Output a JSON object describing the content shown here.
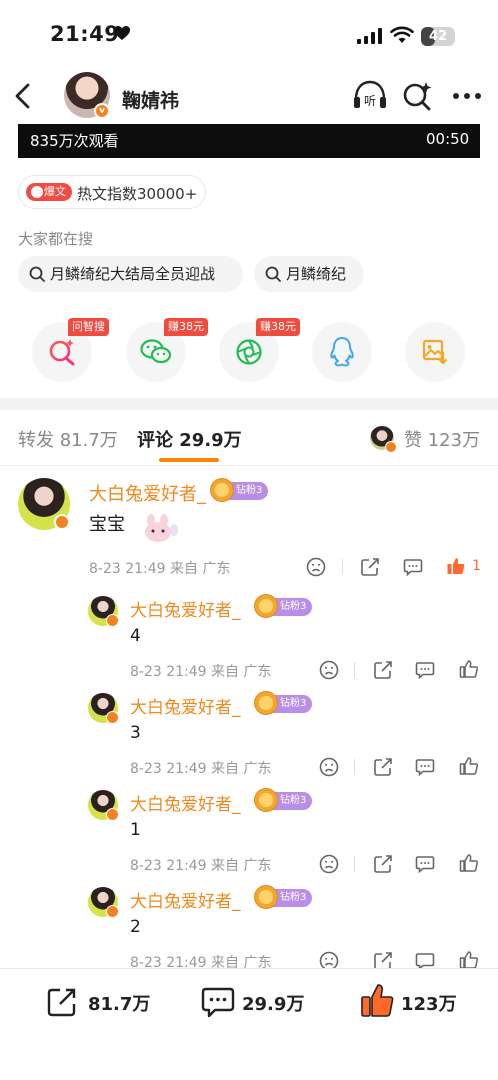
{
  "status_bar": {
    "time": "21:49",
    "battery": "42"
  },
  "nav": {
    "username": "鞠婧祎",
    "avatar_badge": "v"
  },
  "video": {
    "views": "835万次观看",
    "duration": "00:50"
  },
  "hot": {
    "tag": "爆文",
    "text": "热文指数30000+"
  },
  "search_section": {
    "label": "大家都在搜",
    "chips": [
      "月鳞绮纪大结局全员迎战",
      "月鳞绮纪"
    ]
  },
  "share": {
    "items": [
      {
        "icon": "ask-search-icon",
        "tag": "问智搜"
      },
      {
        "icon": "wechat-icon",
        "tag": "赚38元"
      },
      {
        "icon": "moments-icon",
        "tag": "赚38元"
      },
      {
        "icon": "qq-icon",
        "tag": ""
      },
      {
        "icon": "save-image-icon",
        "tag": ""
      }
    ]
  },
  "tabs": {
    "repost": "转发 81.7万",
    "comment": "评论 29.9万",
    "like": "赞 123万"
  },
  "main_comment": {
    "name": "大白兔爱好者_",
    "fan_badge": "钻粉3",
    "text": "宝宝",
    "meta": "8-23 21:49 来自 广东",
    "likes": "1"
  },
  "replies": [
    {
      "name": "大白兔爱好者_",
      "fan_badge": "钻粉3",
      "text": "4",
      "meta": "8-23 21:49 来自 广东"
    },
    {
      "name": "大白兔爱好者_",
      "fan_badge": "钻粉3",
      "text": "3",
      "meta": "8-23 21:49 来自 广东"
    },
    {
      "name": "大白兔爱好者_",
      "fan_badge": "钻粉3",
      "text": "1",
      "meta": "8-23 21:49 来自 广东"
    },
    {
      "name": "大白兔爱好者_",
      "fan_badge": "钻粉3",
      "text": "2",
      "meta": "8-23 21:49 来自 广东"
    }
  ],
  "bottom_bar": {
    "repost": "81.7万",
    "comment": "29.9万",
    "like": "123万"
  },
  "colors": {
    "accent": "#ff8200",
    "name": "#f08a1c",
    "hot": "#f04c45",
    "fan": "#b98ee8",
    "wechat": "#1fbd52"
  }
}
